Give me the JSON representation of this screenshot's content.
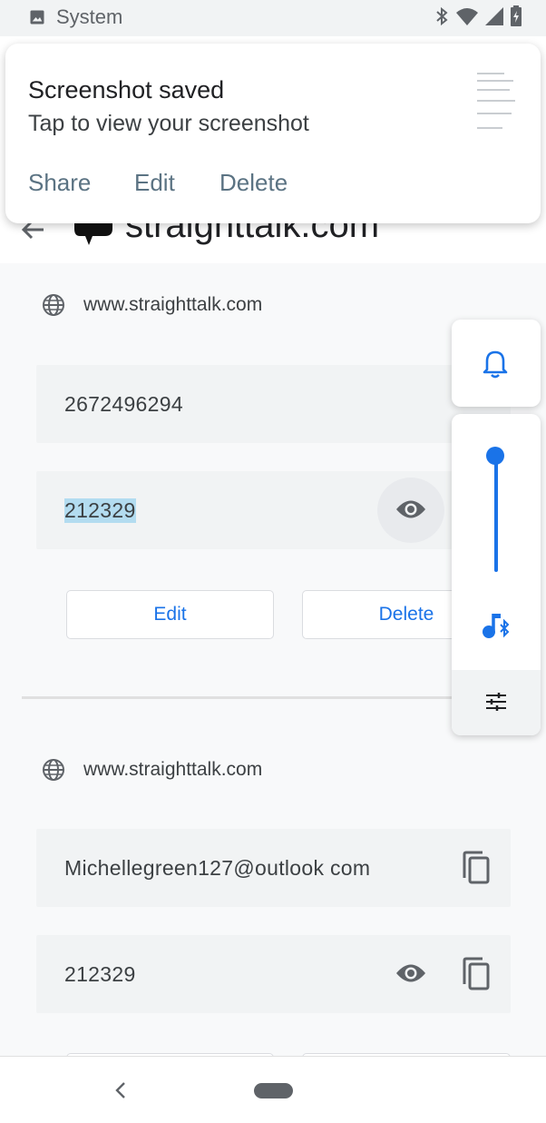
{
  "status_bar": {
    "title": "System",
    "icons": [
      "image-icon",
      "bluetooth-icon",
      "wifi-icon",
      "signal-icon",
      "battery-icon"
    ]
  },
  "header": {
    "site_title": "straighttalk.com"
  },
  "entries": [
    {
      "site": "www.straighttalk.com",
      "username": "2672496294",
      "password": "212329",
      "edit_label": "Edit",
      "delete_label": "Delete"
    },
    {
      "site": "www.straighttalk.com",
      "username": "Michellegreen127@outlook com",
      "password": "212329"
    }
  ],
  "notification": {
    "title": "Screenshot saved",
    "text": "Tap to view your screenshot",
    "actions": [
      "Share",
      "Edit",
      "Delete"
    ]
  },
  "volume_panel": {
    "level": 1.0,
    "accent": "#1a73e8"
  },
  "colors": {
    "accent": "#1a73e8",
    "notif_action": "#5b7383",
    "field_bg": "#f1f3f4",
    "highlight": "#b3dcf0"
  }
}
